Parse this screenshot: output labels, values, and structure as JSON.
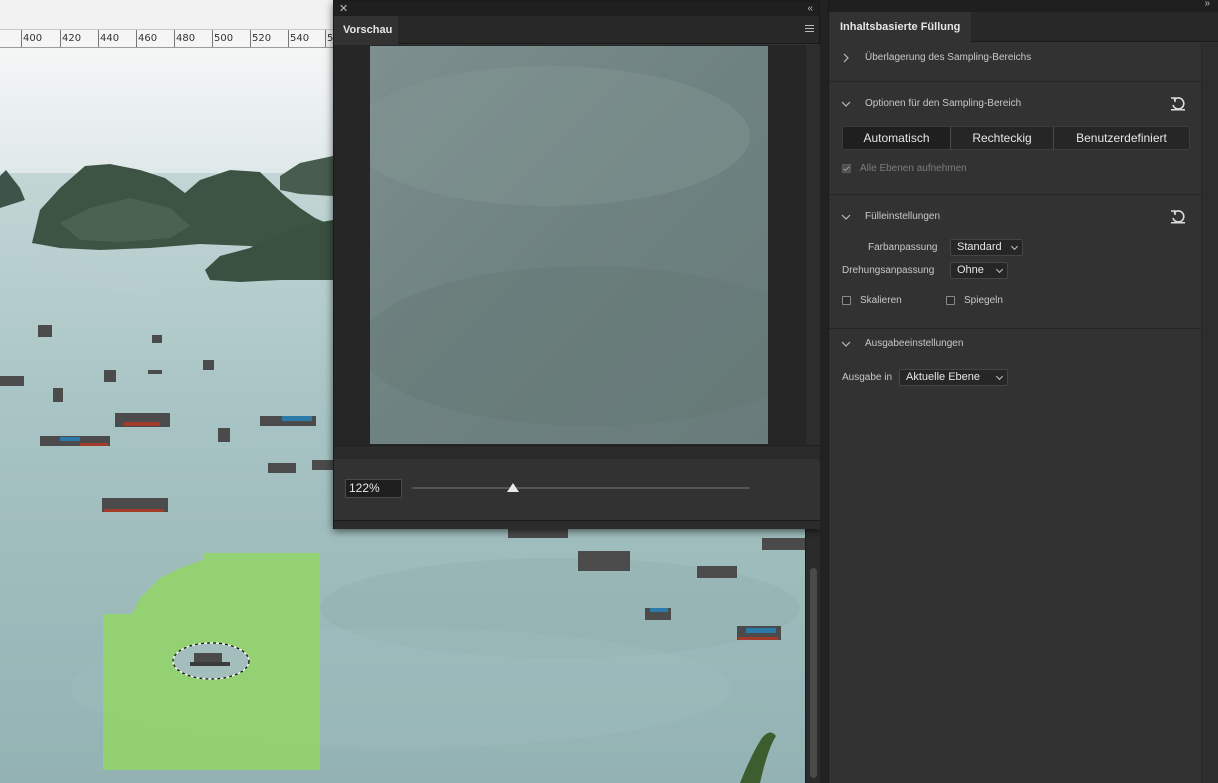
{
  "preview_panel": {
    "title": "Vorschau",
    "zoom_value": "122%",
    "zoom_slider_level_percent": 30
  },
  "ruler": {
    "labels": [
      "400",
      "420",
      "440",
      "460",
      "480",
      "500",
      "520",
      "540",
      "5"
    ]
  },
  "right_panel": {
    "title": "Inhaltsbasierte Füllung",
    "section_overlay": {
      "label": "Überlagerung des Sampling-Bereichs"
    },
    "section_sampling": {
      "label": "Optionen für den Sampling-Bereich",
      "modes": [
        "Automatisch",
        "Rechteckig",
        "Benutzerdefiniert"
      ],
      "selected_mode": "Automatisch",
      "all_layers_label": "Alle Ebenen aufnehmen",
      "all_layers_checked": true
    },
    "section_fill": {
      "label": "Fülleinstellungen",
      "color_label": "Farbanpassung",
      "color_value": "Standard",
      "rotation_label": "Drehungsanpassung",
      "rotation_value": "Ohne",
      "scale_label": "Skalieren",
      "scale_checked": false,
      "mirror_label": "Spiegeln",
      "mirror_checked": false
    },
    "section_output": {
      "label": "Ausgabeeinstellungen",
      "output_label": "Ausgabe in",
      "output_value": "Aktuelle Ebene"
    }
  },
  "colors": {
    "panel_bg": "#323232",
    "fill_overlay": "#93d36b",
    "water": "#9fbcbc"
  },
  "icons": {
    "close": "close-icon",
    "collapse": "collapse-arrows-icon",
    "menu": "panel-menu-icon",
    "reset": "reset-icon",
    "chevron": "chevron-icon"
  }
}
